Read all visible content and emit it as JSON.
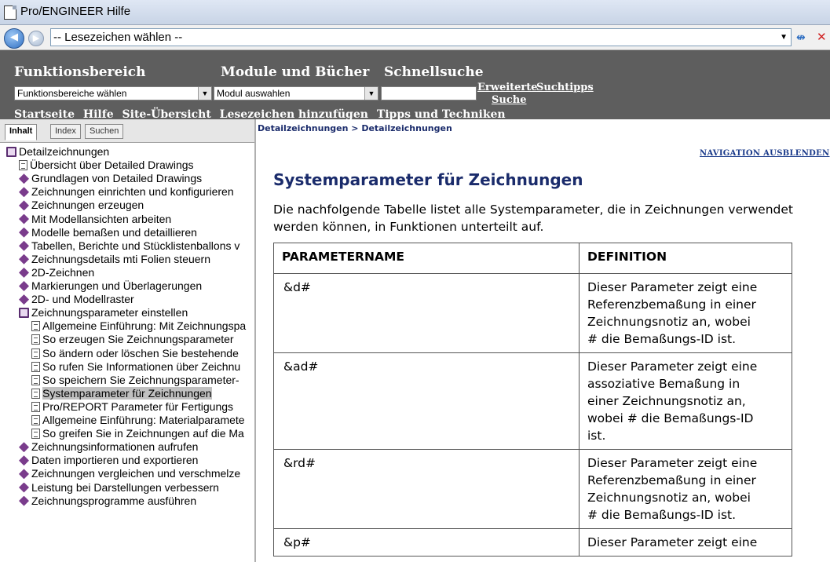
{
  "window": {
    "title": "Pro/ENGINEER Hilfe"
  },
  "navbar": {
    "bookmark_select": "-- Lesezeichen wählen --"
  },
  "header": {
    "label_function_area": "Funktionsbereich",
    "label_modules": "Module und Bücher",
    "label_quick_search": "Schnellsuche",
    "function_area_select": "Funktionsbereiche wählen",
    "module_select": "Modul auswahlen",
    "advanced_search_line1": "Erweiterte",
    "advanced_search_line2": "Suche",
    "search_tips": "Suchtipps",
    "links": [
      "Startseite",
      "Hilfe",
      "Site-Übersicht",
      "Lesezeichen hinzufügen",
      "Tipps und Techniken"
    ]
  },
  "sidebar": {
    "tabs": [
      "Inhalt",
      "Index",
      "Suchen"
    ],
    "active_tab": "Inhalt",
    "tree": [
      {
        "label": "Detailzeichnungen",
        "icon": "openbook",
        "level": 0
      },
      {
        "label": "Übersicht über Detailed Drawings",
        "icon": "page",
        "level": 1
      },
      {
        "label": "Grundlagen von Detailed Drawings",
        "icon": "book",
        "level": 1
      },
      {
        "label": "Zeichnungen einrichten und konfigurieren",
        "icon": "book",
        "level": 1
      },
      {
        "label": "Zeichnungen erzeugen",
        "icon": "book",
        "level": 1
      },
      {
        "label": "Mit Modellansichten arbeiten",
        "icon": "book",
        "level": 1
      },
      {
        "label": "Modelle bemaßen und detaillieren",
        "icon": "book",
        "level": 1
      },
      {
        "label": "Tabellen, Berichte und Stücklistenballons v",
        "icon": "book",
        "level": 1
      },
      {
        "label": "Zeichnungsdetails mti Folien steuern",
        "icon": "book",
        "level": 1
      },
      {
        "label": "2D-Zeichnen",
        "icon": "book",
        "level": 1
      },
      {
        "label": "Markierungen und Überlagerungen",
        "icon": "book",
        "level": 1
      },
      {
        "label": "2D- und Modellraster",
        "icon": "book",
        "level": 1
      },
      {
        "label": "Zeichnungsparameter einstellen",
        "icon": "openbook",
        "level": 1
      },
      {
        "label": "Allgemeine Einführung: Mit Zeichnungspa",
        "icon": "page",
        "level": 2
      },
      {
        "label": "So erzeugen Sie Zeichnungsparameter",
        "icon": "page",
        "level": 2
      },
      {
        "label": "So ändern oder löschen Sie bestehende",
        "icon": "page",
        "level": 2
      },
      {
        "label": "So rufen Sie Informationen über Zeichnu",
        "icon": "page",
        "level": 2
      },
      {
        "label": "So speichern Sie Zeichnungsparameter-",
        "icon": "page",
        "level": 2
      },
      {
        "label": "Systemparameter für Zeichnungen",
        "icon": "page",
        "level": 2,
        "selected": true
      },
      {
        "label": "Pro/REPORT Parameter für Fertigungs",
        "icon": "page",
        "level": 2
      },
      {
        "label": "Allgemeine Einführung: Materialparamete",
        "icon": "page",
        "level": 2
      },
      {
        "label": "So greifen Sie in Zeichnungen auf die Ma",
        "icon": "page",
        "level": 2
      },
      {
        "label": "Zeichnungsinformationen aufrufen",
        "icon": "book",
        "level": 1
      },
      {
        "label": "Daten importieren und exportieren",
        "icon": "book",
        "level": 1
      },
      {
        "label": "Zeichnungen vergleichen und verschmelze",
        "icon": "book",
        "level": 1
      },
      {
        "label": "Leistung bei Darstellungen verbessern",
        "icon": "book",
        "level": 1
      },
      {
        "label": "Zeichnungsprogramme ausführen",
        "icon": "book",
        "level": 1
      }
    ]
  },
  "content": {
    "breadcrumb": "Detailzeichnungen > Detailzeichnungen",
    "nav_hide_link": "NAVIGATION AUSBLENDEN",
    "title": "Systemparameter für Zeichnungen",
    "intro_line1": "Die nachfolgende Tabelle listet alle Systemparameter, die in Zeichnungen verwendet",
    "intro_line2": "werden können, in Funktionen unterteilt auf.",
    "table": {
      "headers": [
        "PARAMETERNAME",
        "DEFINITION"
      ],
      "rows": [
        {
          "name": "&d#",
          "definition": [
            "Dieser Parameter zeigt eine",
            "Referenzbemaßung in einer",
            "Zeichnungsnotiz an, wobei",
            "# die Bemaßungs-ID ist."
          ]
        },
        {
          "name": "&ad#",
          "definition": [
            "Dieser Parameter zeigt eine",
            "assoziative Bemaßung in",
            "einer Zeichnungsnotiz an,",
            "wobei # die Bemaßungs-ID",
            "ist."
          ]
        },
        {
          "name": "&rd#",
          "definition": [
            "Dieser Parameter zeigt eine",
            "Referenzbemaßung in einer",
            "Zeichnungsnotiz an, wobei",
            "# die Bemaßungs-ID ist."
          ]
        },
        {
          "name": "&p#",
          "definition": [
            "Dieser Parameter zeigt eine"
          ]
        }
      ]
    }
  }
}
